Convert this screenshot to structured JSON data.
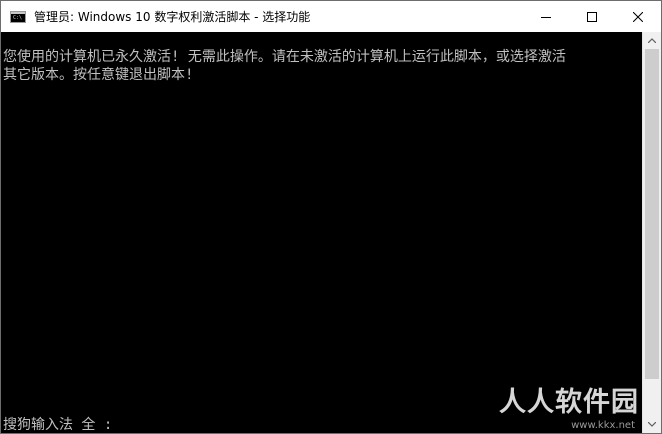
{
  "window": {
    "title": "管理员:  Windows 10 数字权利激活脚本 - 选择功能",
    "icon": "cmd-icon"
  },
  "console": {
    "lines": [
      "您使用的计算机已永久激活! 无需此操作。请在未激活的计算机上运行此脚本，或选择激活",
      "其它版本。按任意键退出脚本!"
    ]
  },
  "ime": {
    "status": "搜狗输入法 全 :"
  },
  "watermark": {
    "text": "人人软件园",
    "sub": "www.kkx.net"
  },
  "colors": {
    "console_bg": "#000000",
    "console_fg": "#c0c0c0"
  }
}
